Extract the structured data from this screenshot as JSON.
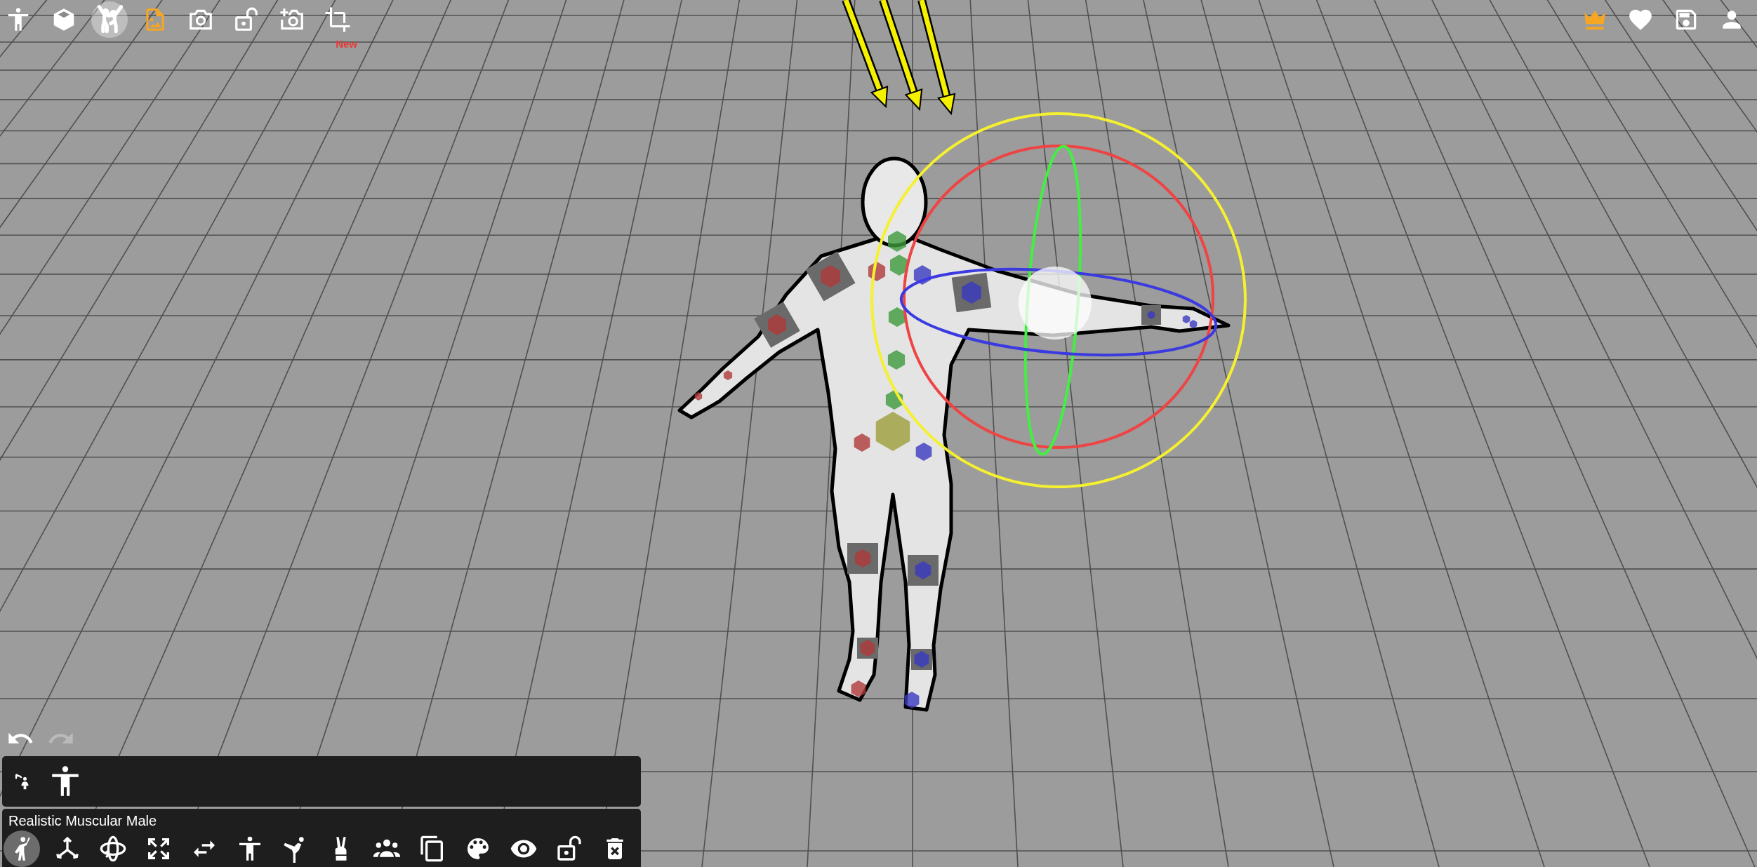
{
  "top_toolbar": {
    "left": [
      {
        "selected": false,
        "color": "#ffffff"
      },
      {
        "selected": false,
        "color": "#ffffff"
      },
      {
        "selected": true,
        "color": "#ffffff"
      },
      {
        "selected": false,
        "color": "#f5a623"
      },
      {
        "selected": false,
        "color": "#ffffff"
      },
      {
        "selected": false,
        "color": "#ffffff"
      },
      {
        "selected": false,
        "color": "#ffffff"
      },
      {
        "selected": false,
        "color": "#ffffff",
        "badge": "New"
      }
    ],
    "right": [
      {
        "color": "#f5a623"
      },
      {
        "color": "#ffffff"
      },
      {
        "color": "#ffffff"
      },
      {
        "color": "#ffffff"
      }
    ]
  },
  "history": {
    "undo": {
      "disabled": false
    },
    "redo": {
      "disabled": true
    }
  },
  "model_panel": {
    "title": "Realistic Muscular Male",
    "tools": [
      {
        "selected": true
      },
      {
        "selected": false
      },
      {
        "selected": false
      },
      {
        "selected": false
      },
      {
        "selected": false
      },
      {
        "selected": false
      },
      {
        "selected": false
      },
      {
        "selected": false
      },
      {
        "selected": false
      },
      {
        "selected": false
      },
      {
        "selected": false
      },
      {
        "selected": false
      },
      {
        "selected": false
      },
      {
        "selected": false
      }
    ]
  }
}
